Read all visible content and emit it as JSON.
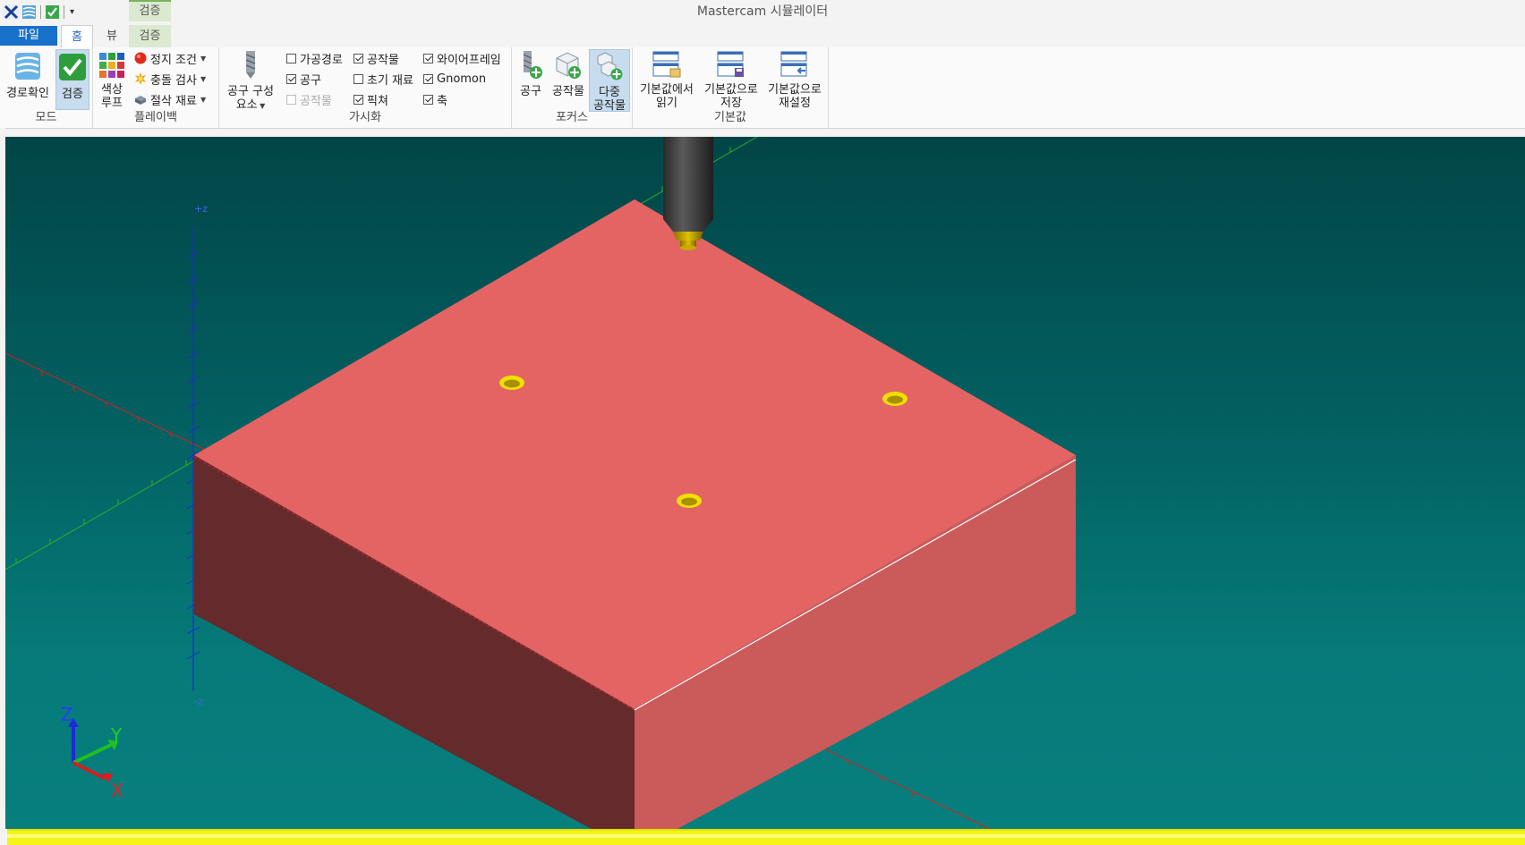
{
  "app": {
    "title": "Mastercam 시뮬레이터"
  },
  "context_tab": {
    "label": "검증"
  },
  "tabs": {
    "file": "파일",
    "home": "홈",
    "view": "뷰",
    "verify": "검증"
  },
  "ribbon": {
    "mode": {
      "label": "모드",
      "path_check": "경로확인",
      "verify": "검증"
    },
    "playback": {
      "label": "플레이백",
      "color_loop_line1": "색상",
      "color_loop_line2": "루프",
      "stop_condition": "정지 조건",
      "collision_check": "충돌 검사",
      "cut_stock": "절삭 재료"
    },
    "visualization": {
      "label": "가시화",
      "tool_components_line1": "공구 구성",
      "tool_components_line2": "요소",
      "toolpath": "가공경로",
      "tool": "공구",
      "workpiece_disabled": "공작물",
      "workpiece": "공작물",
      "initial_stock": "초기 재료",
      "fixture": "픽쳐",
      "wireframe": "와이어프레임",
      "gnomon": "Gnomon",
      "axis": "축"
    },
    "focus": {
      "label": "포커스",
      "tool": "공구",
      "workpiece": "공작물",
      "multi_line1": "다중",
      "multi_line2": "공작물"
    },
    "defaults": {
      "label": "기본값",
      "read_line1": "기본값에서",
      "read_line2": "읽기",
      "save_line1": "기본값으로",
      "save_line2": "저장",
      "reset_line1": "기본값으로",
      "reset_line2": "재설정"
    }
  },
  "checkboxes": {
    "toolpath": false,
    "tool": true,
    "workpiece_disabled": false,
    "workpiece": true,
    "initial_stock": false,
    "fixture": true,
    "wireframe": true,
    "gnomon": true,
    "axis": true
  },
  "viewport": {
    "axis_labels": {
      "z_plus": "+z",
      "z_minus": "-z"
    },
    "gnomon": {
      "x": "X",
      "y": "Y",
      "z": "Z"
    },
    "colors": {
      "block_top": "#e46464",
      "block_left": "#652a2c",
      "block_right": "#cb5a5a",
      "hole": "#f0e000",
      "tool": "#3a3a3a",
      "tool_tip": "#c9a800"
    }
  },
  "icons": [
    "path-check-icon",
    "verify-icon",
    "color-loop-icon",
    "stop-icon",
    "collision-icon",
    "cut-stock-icon",
    "tool-components-icon",
    "focus-tool-icon",
    "focus-workpiece-icon",
    "focus-multi-icon",
    "defaults-read-icon",
    "defaults-save-icon",
    "defaults-reset-icon"
  ]
}
